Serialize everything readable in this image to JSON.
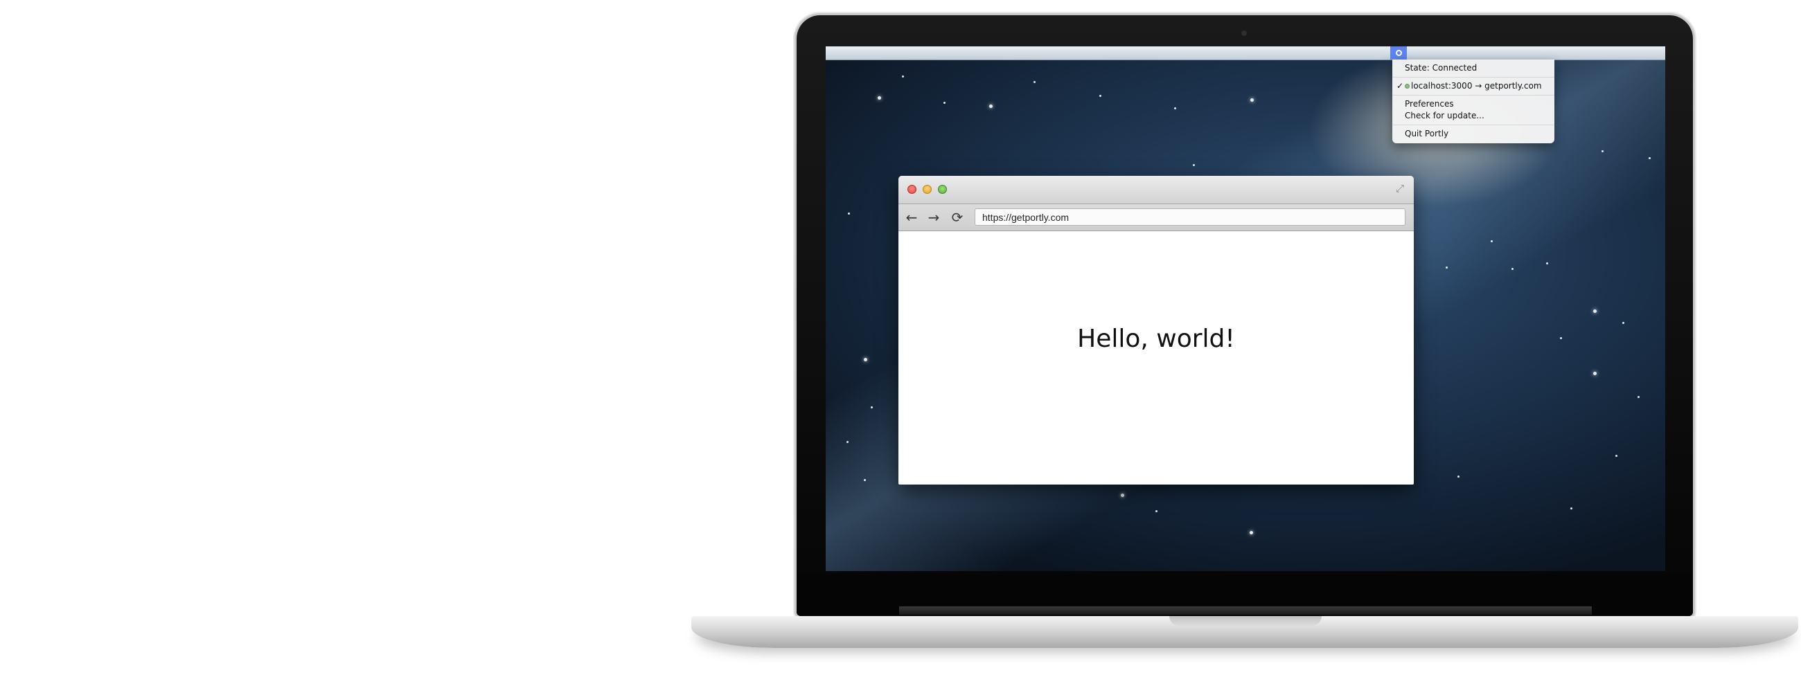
{
  "menubar": {
    "status_item_icon": "portly-status-icon",
    "dropdown": {
      "state": "State: Connected",
      "tunnel_check": "✓",
      "tunnel": "localhost:3000 → getportly.com",
      "preferences": "Preferences",
      "check_update": "Check for update...",
      "quit": "Quit Portly"
    }
  },
  "browser": {
    "url": "https://getportly.com",
    "page_heading": "Hello, world!",
    "icons": {
      "back": "←",
      "forward": "→",
      "reload": "⟳",
      "fullscreen": "⤢"
    }
  },
  "colors": {
    "menu_highlight": "#5f83f0",
    "connected_dot": "#8abf7a"
  }
}
